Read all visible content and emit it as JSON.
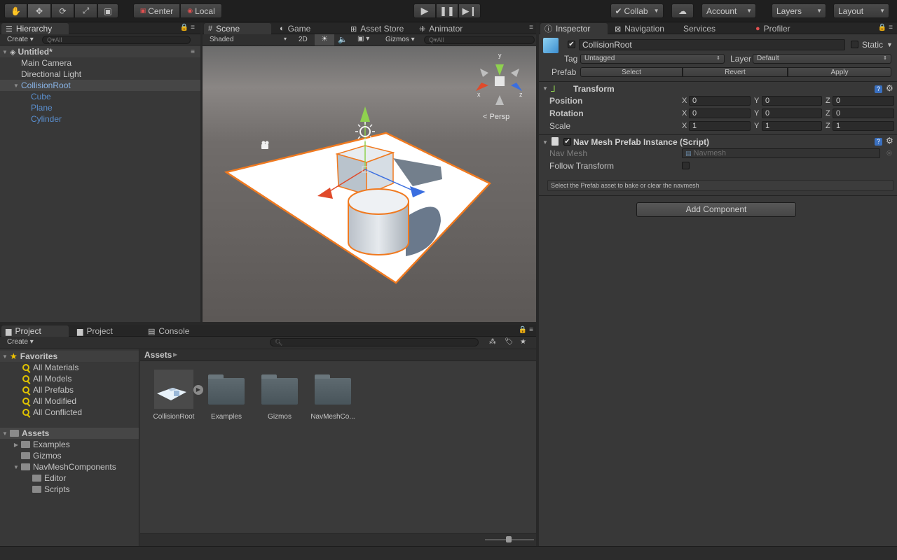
{
  "toolbar": {
    "center_label": "Center",
    "local_label": "Local",
    "collab_label": "Collab",
    "account_label": "Account",
    "layers_label": "Layers",
    "layout_label": "Layout"
  },
  "hierarchy": {
    "tab_label": "Hierarchy",
    "create_label": "Create",
    "search_placeholder": "Q▾All",
    "scene_name": "Untitled*",
    "items": [
      "Main Camera",
      "Directional Light",
      "CollisionRoot",
      "Cube",
      "Plane",
      "Cylinder"
    ]
  },
  "scene": {
    "tabs": [
      "Scene",
      "Game",
      "Asset Store",
      "Animator"
    ],
    "shading_label": "Shaded",
    "mode_2d_label": "2D",
    "gizmos_label": "Gizmos",
    "search_placeholder": "Q▾All",
    "persp_label": "Persp",
    "gizmo_axes": [
      "y",
      "x",
      "z"
    ]
  },
  "inspector": {
    "tabs": [
      "Inspector",
      "Navigation",
      "Services",
      "Profiler"
    ],
    "object_name": "CollisionRoot",
    "static_label": "Static",
    "tag_label": "Tag",
    "tag_value": "Untagged",
    "layer_label": "Layer",
    "layer_value": "Default",
    "prefab_label": "Prefab",
    "prefab_buttons": [
      "Select",
      "Revert",
      "Apply"
    ],
    "transform": {
      "title": "Transform",
      "rows": [
        {
          "label": "Position",
          "x": "0",
          "y": "0",
          "z": "0"
        },
        {
          "label": "Rotation",
          "x": "0",
          "y": "0",
          "z": "0"
        },
        {
          "label": "Scale",
          "x": "1",
          "y": "1",
          "z": "1"
        }
      ],
      "axis_labels": [
        "X",
        "Y",
        "Z"
      ]
    },
    "navmesh": {
      "title": "Nav Mesh Prefab Instance (Script)",
      "nav_mesh_label": "Nav Mesh",
      "nav_mesh_value": "Navmesh",
      "follow_label": "Follow Transform",
      "help_text": "Select the Prefab asset to bake or clear the navmesh"
    },
    "add_component_label": "Add Component"
  },
  "project": {
    "tabs": [
      "Project",
      "Project",
      "Console"
    ],
    "create_label": "Create",
    "favorites_label": "Favorites",
    "favorites": [
      "All Materials",
      "All Models",
      "All Prefabs",
      "All Modified",
      "All Conflicted"
    ],
    "assets_label": "Assets",
    "assets_tree": [
      {
        "label": "Examples",
        "indent": 1,
        "arrow": "▶"
      },
      {
        "label": "Gizmos",
        "indent": 1,
        "arrow": ""
      },
      {
        "label": "NavMeshComponents",
        "indent": 1,
        "arrow": "▼"
      },
      {
        "label": "Editor",
        "indent": 2,
        "arrow": ""
      },
      {
        "label": "Scripts",
        "indent": 2,
        "arrow": ""
      }
    ],
    "breadcrumb": "Assets",
    "grid": [
      "CollisionRoot",
      "Examples",
      "Gizmos",
      "NavMeshCo..."
    ]
  }
}
